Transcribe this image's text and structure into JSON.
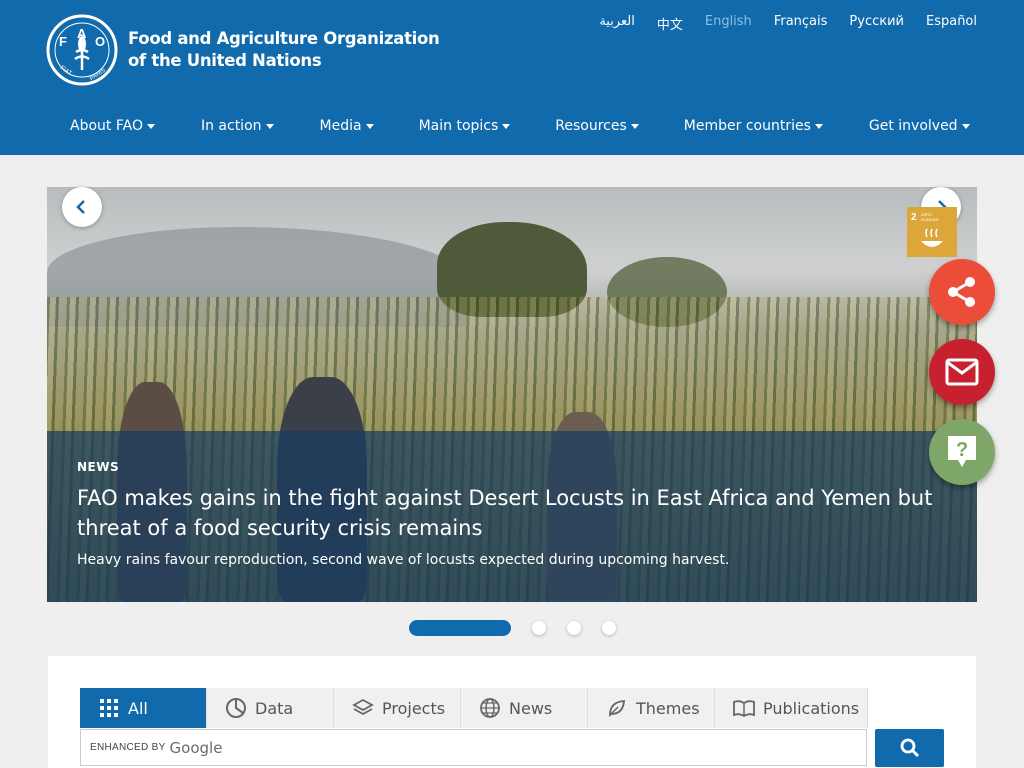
{
  "header": {
    "org_name_line1": "Food and Agriculture Organization",
    "org_name_line2": "of the United Nations",
    "logo_text": "FAO FIAT PANIS",
    "brand_color": "#116aab"
  },
  "languages": [
    {
      "label": "العربية",
      "active": false
    },
    {
      "label": "中文",
      "active": false
    },
    {
      "label": "English",
      "active": true
    },
    {
      "label": "Français",
      "active": false
    },
    {
      "label": "Русский",
      "active": false
    },
    {
      "label": "Español",
      "active": false
    }
  ],
  "nav": [
    {
      "label": "About FAO"
    },
    {
      "label": "In action"
    },
    {
      "label": "Media"
    },
    {
      "label": "Main topics"
    },
    {
      "label": "Resources"
    },
    {
      "label": "Member countries"
    },
    {
      "label": "Get involved"
    }
  ],
  "carousel": {
    "tag": "NEWS",
    "title": "FAO makes gains in the fight against Desert Locusts in East Africa and Yemen but threat of a food security crisis remains",
    "subtitle": "Heavy rains favour reproduction, second wave of locusts expected during upcoming harvest.",
    "sdg_badge": "2 ZERO HUNGER",
    "slide_count": 4,
    "active_slide": 1
  },
  "floating_buttons": [
    {
      "name": "share",
      "icon": "share-icon",
      "color": "#eb4d38"
    },
    {
      "name": "mail",
      "icon": "mail-icon",
      "color": "#c7202e"
    },
    {
      "name": "help",
      "icon": "help-icon",
      "color": "#7fa669"
    }
  ],
  "search": {
    "tabs": [
      {
        "label": "All",
        "icon": "grid-icon",
        "active": true
      },
      {
        "label": "Data",
        "icon": "pie-icon",
        "active": false
      },
      {
        "label": "Projects",
        "icon": "layers-icon",
        "active": false
      },
      {
        "label": "News",
        "icon": "globe-icon",
        "active": false
      },
      {
        "label": "Themes",
        "icon": "leaf-icon",
        "active": false
      },
      {
        "label": "Publications",
        "icon": "book-icon",
        "active": false
      }
    ],
    "enhanced_label": "ENHANCED BY",
    "google_label": "Google"
  }
}
